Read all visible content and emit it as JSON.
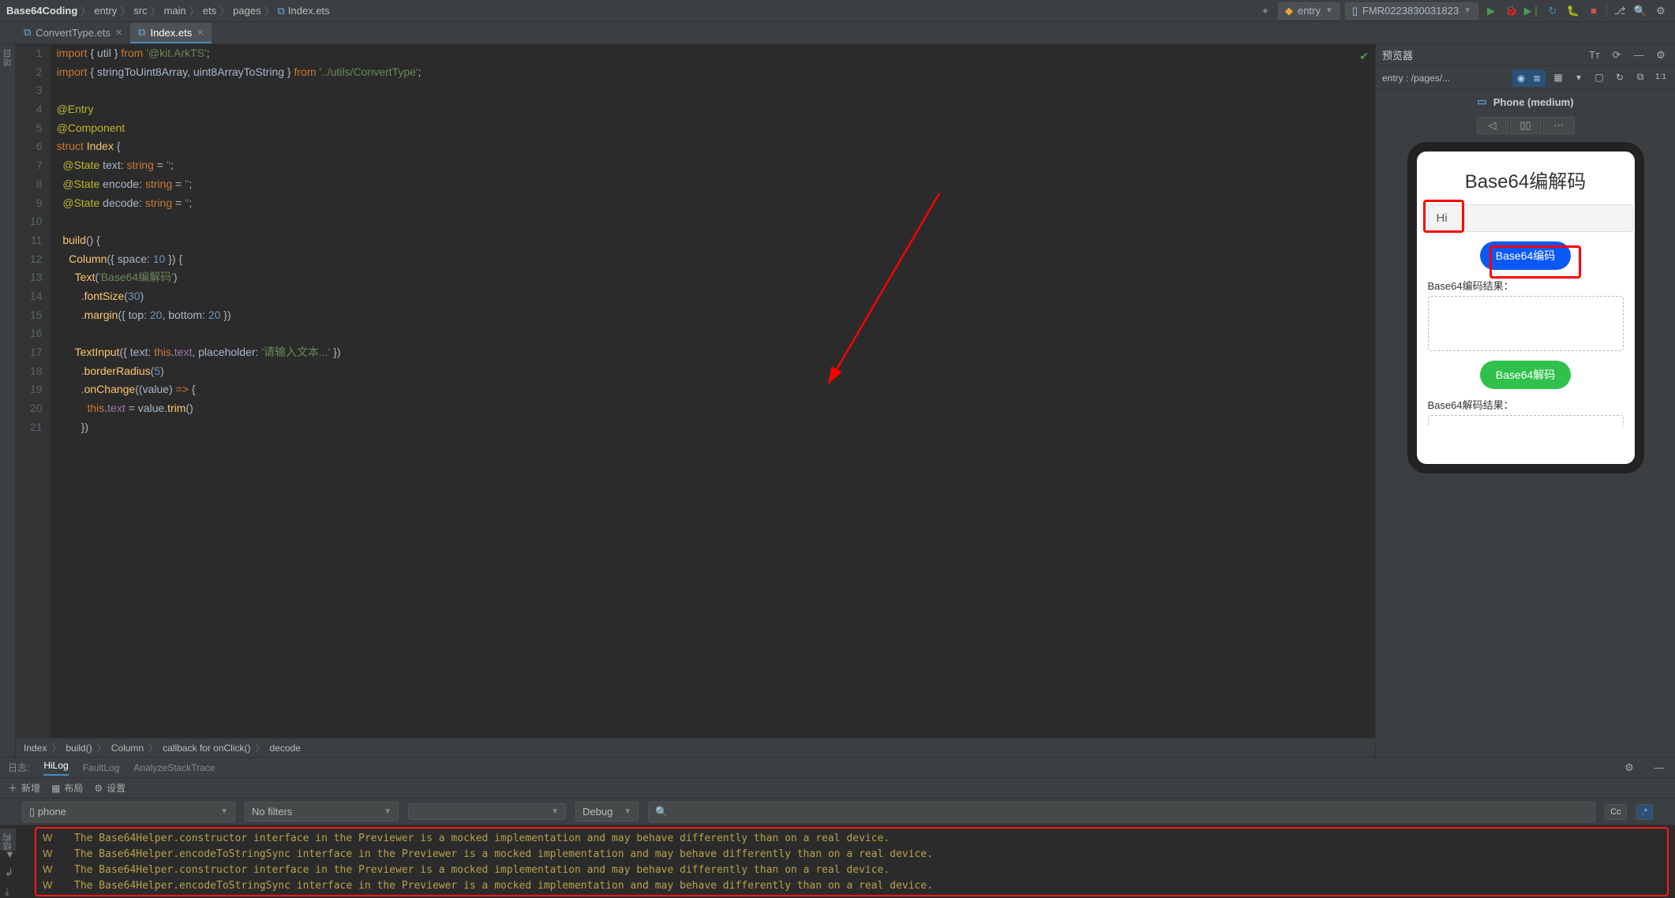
{
  "topbar": {
    "project": "Base64Coding",
    "crumbs": [
      "entry",
      "src",
      "main",
      "ets",
      "pages"
    ],
    "file": "Index.ets",
    "run_config": "entry",
    "device": "FMR0223830031823"
  },
  "tabs": [
    {
      "label": "ConvertType.ets",
      "active": false
    },
    {
      "label": "Index.ets",
      "active": true
    }
  ],
  "side_labels": {
    "project": "项目",
    "structure": "结构"
  },
  "code": {
    "lines": [
      {
        "n": 1,
        "html": "<span class='kw'>import</span> { <span class='id'>util</span> } <span class='kw'>from</span> <span class='str'>'@kit.ArkTS'</span>;"
      },
      {
        "n": 2,
        "html": "<span class='kw'>import</span> { <span class='id'>stringToUint8Array</span>, <span class='id'>uint8ArrayToString</span> } <span class='kw'>from</span> <span class='str'>'../utils/ConvertType'</span>;"
      },
      {
        "n": 3,
        "html": ""
      },
      {
        "n": 4,
        "html": "<span class='deco'>@Entry</span>"
      },
      {
        "n": 5,
        "html": "<span class='deco'>@Component</span>"
      },
      {
        "n": 6,
        "html": "<span class='kw'>struct</span> <span class='typ'>Index</span> {"
      },
      {
        "n": 7,
        "html": "  <span class='deco'>@State</span> <span class='id'>text</span>: <span class='kw'>string</span> = <span class='str'>''</span>;"
      },
      {
        "n": 8,
        "html": "  <span class='deco'>@State</span> <span class='id'>encode</span>: <span class='kw'>string</span> = <span class='str'>''</span>;"
      },
      {
        "n": 9,
        "html": "  <span class='deco'>@State</span> <span class='id'>decode</span>: <span class='kw'>string</span> = <span class='str'>''</span>;"
      },
      {
        "n": 10,
        "html": ""
      },
      {
        "n": 11,
        "html": "  <span class='fn'>build</span>() {"
      },
      {
        "n": 12,
        "html": "    <span class='typ'>Column</span>({ <span class='id'>space</span>: <span class='num'>10</span> }) {"
      },
      {
        "n": 13,
        "html": "      <span class='typ'>Text</span>(<span class='str'>'Base64编解码'</span>)"
      },
      {
        "n": 14,
        "html": "        .<span class='fn'>fontSize</span>(<span class='num'>30</span>)"
      },
      {
        "n": 15,
        "html": "        .<span class='fn'>margin</span>({ <span class='id'>top</span>: <span class='num'>20</span>, <span class='id'>bottom</span>: <span class='num'>20</span> })"
      },
      {
        "n": 16,
        "html": ""
      },
      {
        "n": 17,
        "html": "      <span class='typ'>TextInput</span>({ <span class='id'>text</span>: <span class='kw'>this</span>.<span class='prop'>text</span>, <span class='id'>placeholder</span>: <span class='str'>'请输入文本...'</span> })"
      },
      {
        "n": 18,
        "html": "        .<span class='fn'>borderRadius</span>(<span class='num'>5</span>)"
      },
      {
        "n": 19,
        "html": "        .<span class='fn'>onChange</span>((<span class='id'>value</span>) <span class='kw'>=&gt;</span> {"
      },
      {
        "n": 20,
        "html": "          <span class='kw'>this</span>.<span class='prop'>text</span> = <span class='id'>value</span>.<span class='fn'>trim</span>()"
      },
      {
        "n": 21,
        "html": "        })"
      }
    ]
  },
  "code_crumbs": [
    "Index",
    "build()",
    "Column",
    "callback for onClick()",
    "decode"
  ],
  "preview": {
    "title": "预览器",
    "path": "entry : /pages/...",
    "device_label": "Phone (medium)",
    "app": {
      "heading": "Base64编解码",
      "input_value": "Hi",
      "encode_btn": "Base64编码",
      "encode_res_label": "Base64编码结果：",
      "decode_btn": "Base64解码",
      "decode_res_label": "Base64解码结果："
    }
  },
  "log": {
    "panel_label": "日志:",
    "tabs": [
      "HiLog",
      "FaultLog",
      "AnalyzeStackTrace"
    ],
    "toolbar": {
      "add": "新增",
      "layout": "布局",
      "settings": "设置"
    },
    "filters": {
      "device": "phone",
      "filter": "No filters",
      "tag": "",
      "level": "Debug",
      "search": "",
      "cc": "Cc"
    },
    "lines": [
      {
        "level": "W",
        "msg": "The Base64Helper.constructor interface in the Previewer is a mocked implementation and may behave differently than on a real device."
      },
      {
        "level": "W",
        "msg": "The Base64Helper.encodeToStringSync interface in the Previewer is a mocked implementation and may behave differently than on a real device."
      },
      {
        "level": "W",
        "msg": "The Base64Helper.constructor interface in the Previewer is a mocked implementation and may behave differently than on a real device."
      },
      {
        "level": "W",
        "msg": "The Base64Helper.encodeToStringSync interface in the Previewer is a mocked implementation and may behave differently than on a real device."
      }
    ]
  }
}
